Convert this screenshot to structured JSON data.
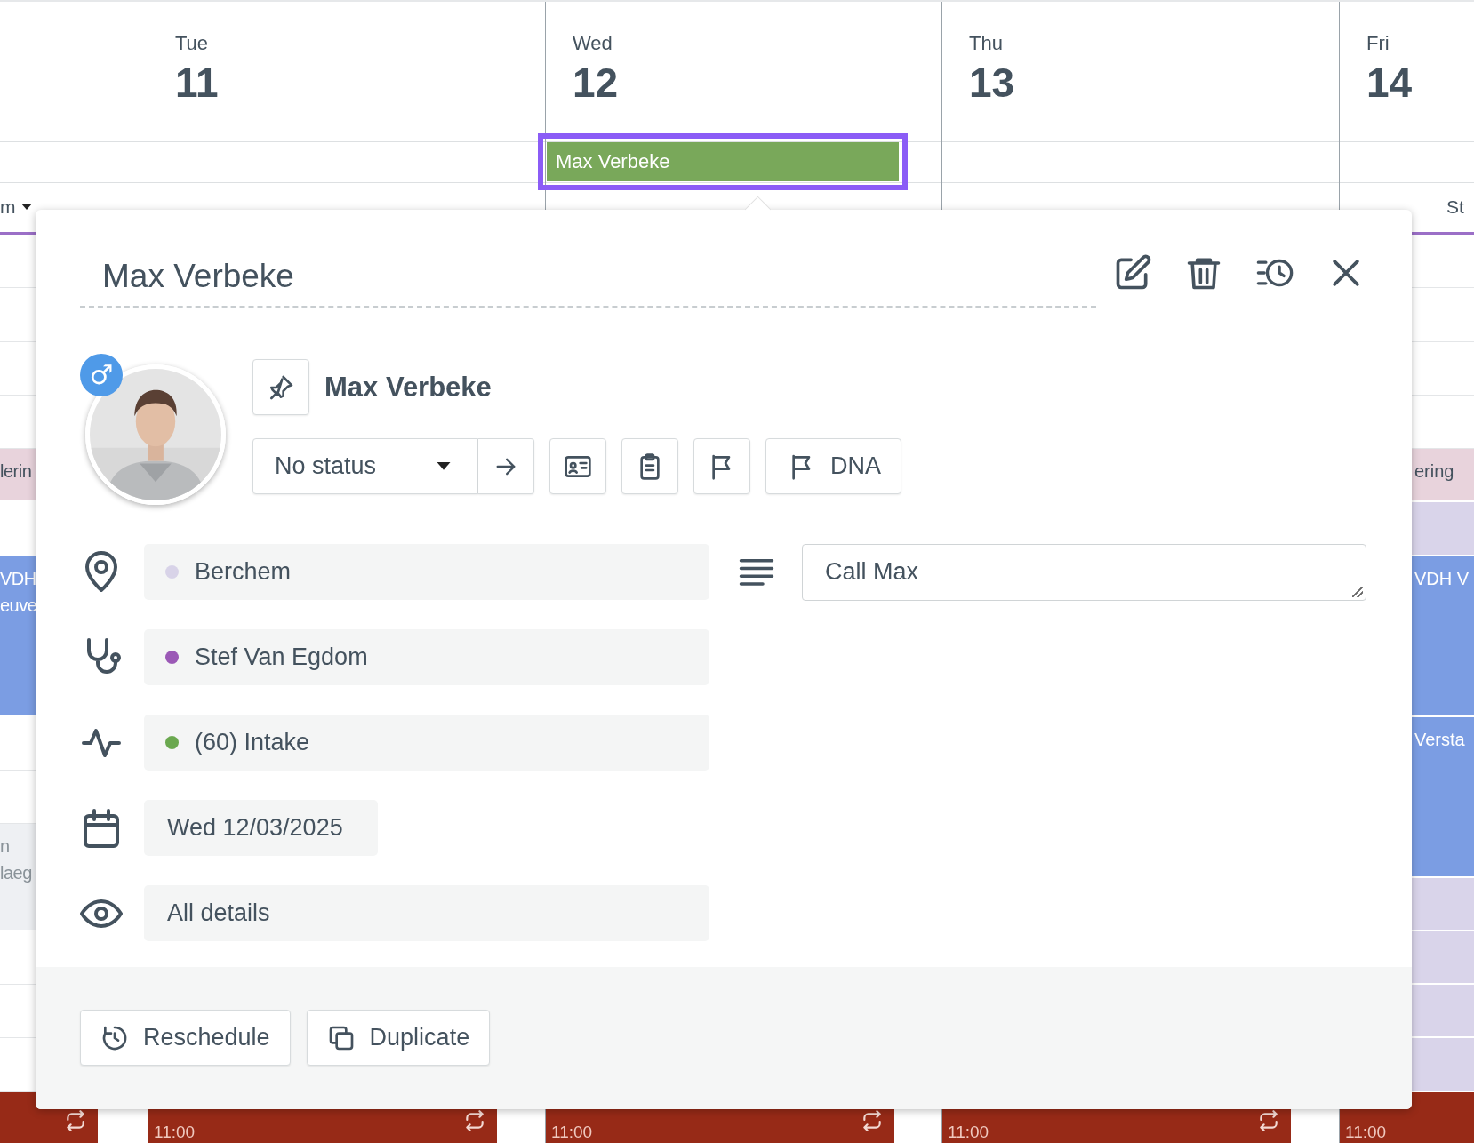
{
  "calendar": {
    "columns": [
      {
        "resource": "m",
        "slots": [
          {
            "kind": "free"
          },
          {
            "kind": "free"
          },
          {
            "kind": "free"
          },
          {
            "kind": "free"
          },
          {
            "kind": "short",
            "color": "#e8d3dc",
            "lines": [
              "lerin"
            ]
          },
          {
            "kind": "free"
          },
          {
            "kind": "long",
            "color": "#7b9de3",
            "lines": [
              "VDH",
              "euve"
            ]
          },
          {
            "kind": "free"
          },
          {
            "kind": "free"
          },
          {
            "kind": "medium",
            "color": "#eef0f3",
            "lines": [
              "n",
              "laeg"
            ]
          },
          {
            "kind": "free"
          },
          {
            "kind": "free"
          },
          {
            "kind": "free"
          }
        ],
        "pause": {
          "repeat": true
        }
      },
      {
        "weekday": "Tue",
        "day": "11",
        "pause": {
          "time": "11:00",
          "repeat": true
        }
      },
      {
        "weekday": "Wed",
        "day": "12",
        "allday": {
          "title": "Max Verbeke",
          "selected": true
        },
        "pause": {
          "time": "11:00",
          "repeat": true
        }
      },
      {
        "weekday": "Thu",
        "day": "13",
        "pause": {
          "time": "11:00",
          "repeat": true
        }
      },
      {
        "weekday": "Fri",
        "day": "14",
        "resource": "St",
        "slots": [
          {
            "kind": "free"
          },
          {
            "kind": "free"
          },
          {
            "kind": "free"
          },
          {
            "kind": "free"
          },
          {
            "kind": "short",
            "color": "#e8d3dc",
            "lines": [
              "ering"
            ]
          },
          {
            "kind": "short",
            "color": "#d9d4ea"
          },
          {
            "kind": "long",
            "color": "#7b9de3",
            "lines": [
              "VDH V"
            ]
          },
          {
            "kind": "long",
            "color": "#7b9de3",
            "lines": [
              "Versta"
            ]
          },
          {
            "kind": "short",
            "color": "#d9d4ea"
          },
          {
            "kind": "short",
            "color": "#d9d4ea"
          },
          {
            "kind": "short",
            "color": "#d9d4ea"
          },
          {
            "kind": "short",
            "color": "#d9d4ea"
          }
        ],
        "pause": {
          "time": "11:00",
          "repeat": false
        }
      }
    ]
  },
  "popup": {
    "title": "Max Verbeke",
    "patient": {
      "name": "Max Verbeke",
      "gender_symbol": "♂"
    },
    "status": {
      "value": "No status"
    },
    "flag_button": "DNA",
    "fields": [
      {
        "kind": "location",
        "value": "Berchem",
        "color": "#d8d3e8"
      },
      {
        "kind": "practitioner",
        "value": "Stef Van Egdom",
        "color": "#9b59b6"
      },
      {
        "kind": "type",
        "value": "(60) Intake",
        "color": "#6aa84f"
      },
      {
        "kind": "date",
        "value": "Wed 12/03/2025"
      },
      {
        "kind": "visibility",
        "value": "All details"
      }
    ],
    "note": {
      "value": "Call Max"
    },
    "actions": [
      {
        "kind": "reschedule",
        "label": "Reschedule"
      },
      {
        "kind": "duplicate",
        "label": "Duplicate"
      }
    ]
  }
}
